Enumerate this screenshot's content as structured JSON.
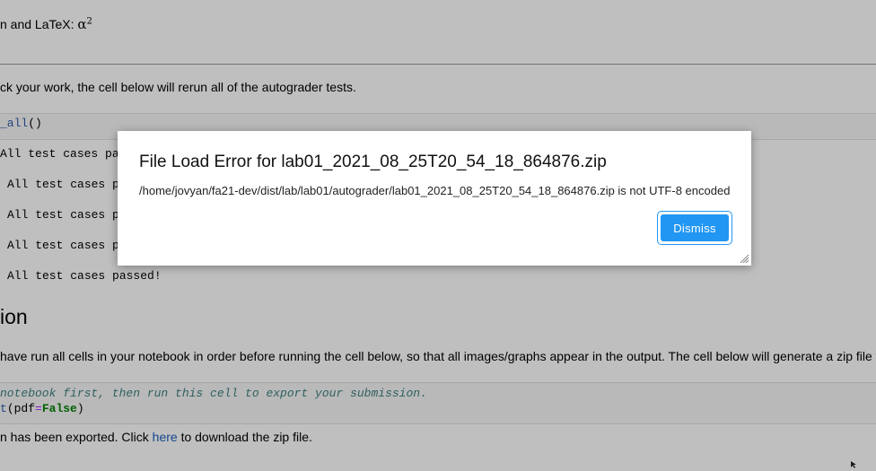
{
  "notebook": {
    "latex_line_prefix": "n and LaTeX: ",
    "latex_symbol": "α",
    "latex_superscript": "2",
    "check_work_text": "ck your work, the cell below will rerun all of the autograder tests.",
    "code_check_all": "_all",
    "code_check_all_parens": "()",
    "outputs": [
      "All test cases pa",
      "All test cases p",
      "All test cases p",
      "All test cases p",
      "All test cases passed!"
    ],
    "section_heading": "ion",
    "submission_text": " have run all cells in your notebook in order before running the cell below, so that all images/graphs appear in the output. The cell below will generate a zip file f",
    "code_comment": "notebook first, then run this cell to export your submission.",
    "code_export_fn": "t",
    "code_export_open": "(pdf",
    "code_export_eq": "=",
    "code_export_false": "False",
    "code_export_close": ")",
    "exported_text_before": "n has been exported. Click ",
    "exported_link": "here",
    "exported_text_after": " to download the zip file."
  },
  "dialog": {
    "title": "File Load Error for lab01_2021_08_25T20_54_18_864876.zip",
    "message": "/home/jovyan/fa21-dev/dist/lab/lab01/autograder/lab01_2021_08_25T20_54_18_864876.zip is not UTF-8 encoded",
    "dismiss_label": "Dismiss"
  },
  "colors": {
    "accent": "#2196f3",
    "link": "#1a5fbf"
  }
}
